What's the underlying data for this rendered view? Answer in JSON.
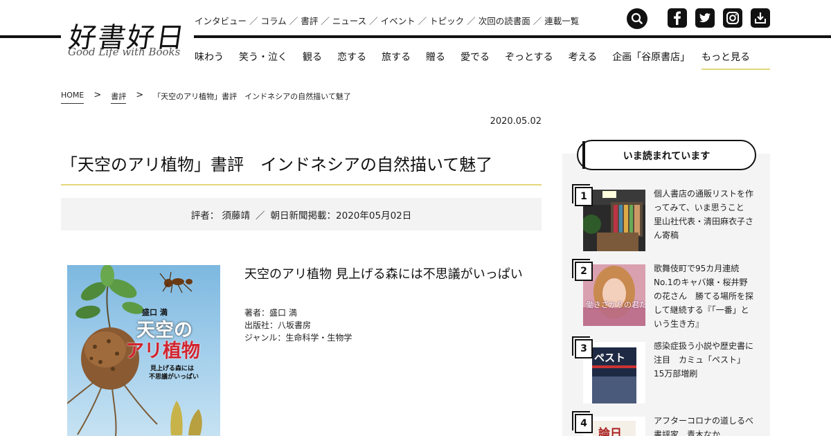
{
  "logo": {
    "main": "好書好日",
    "sub": "Good Life with Books"
  },
  "subnav": [
    "インタビュー",
    "コラム",
    "書評",
    "ニュース",
    "イベント",
    "トピック",
    "次回の読書面",
    "連載一覧"
  ],
  "subnav_separator": "／",
  "mainnav": [
    "味わう",
    "笑う・泣く",
    "観る",
    "恋する",
    "旅する",
    "贈る",
    "愛でる",
    "ぞっとする",
    "考える",
    "企画「谷原書店」"
  ],
  "mainnav_more": "もっと見る",
  "icons": {
    "search": "search-icon",
    "facebook": "facebook-icon",
    "twitter": "twitter-icon",
    "instagram": "instagram-icon",
    "download": "download-icon"
  },
  "breadcrumb": {
    "home": "HOME",
    "category": "書評",
    "current": "「天空のアリ植物」書評　インドネシアの自然描いて魅了",
    "separator": ">"
  },
  "article": {
    "date": "2020.05.02",
    "title": "「天空のアリ植物」書評　インドネシアの自然描いて魅了",
    "reviewer": "評者： 須藤靖",
    "meta_separator": "／",
    "published": "朝日新聞掲載：2020年05月02日"
  },
  "book": {
    "title": "天空のアリ植物 見上げる森には不思議がいっぱい",
    "author": "著者：盛口 満",
    "publisher": "出版社：八坂書房",
    "genre": "ジャンル：生命科学・生物学",
    "cover": {
      "author": "盛口 満",
      "title_line1": "天空の",
      "title_line2": "アリ植物",
      "subtitle_line1": "見上げる森には",
      "subtitle_line2": "不思議がいっぱい"
    }
  },
  "ranking": {
    "heading": "いま読まれています",
    "items": [
      {
        "rank": "1",
        "text": "個人書店の通販リストを作ってみて、いま思うこと　里山社代表・清田麻衣子さん寄稿"
      },
      {
        "rank": "2",
        "text": "歌舞伎町で95カ月連続No.1のキャバ嬢・桜井野の花さん　勝てる場所を探して継続する『「一番」という生き方』",
        "thumb_text": "働きざかりの君たちへ"
      },
      {
        "rank": "3",
        "text": "感染症扱う小説や歴史書に注目　カミュ「ペスト」15万部増刷",
        "thumb_text": "ペスト"
      },
      {
        "rank": "4",
        "text": "アフターコロナの道しるべ　書評家　青木なか",
        "thumb_text": "論日"
      }
    ]
  },
  "colors": {
    "accent_rule": "#e2d67a",
    "meta_bg": "#f3f3f3",
    "sidebar_bg": "#f4f4f4",
    "cover_title_red": "#d2242e"
  }
}
